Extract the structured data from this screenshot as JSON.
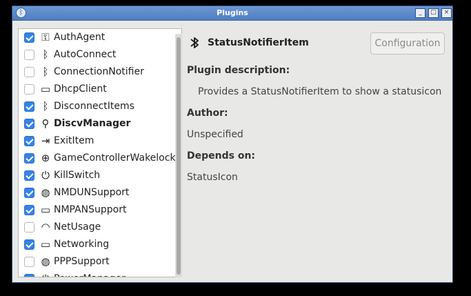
{
  "window": {
    "title": "Plugins",
    "app_icon": "bluetooth-icon",
    "controls": {
      "minimize": "_",
      "maximize": "□",
      "close": "×"
    }
  },
  "plugins": [
    {
      "name": "AuthAgent",
      "checked": true,
      "icon": "key-icon",
      "glyph": "⚿"
    },
    {
      "name": "AutoConnect",
      "checked": false,
      "icon": "bluetooth-icon",
      "glyph": "ᛒ"
    },
    {
      "name": "ConnectionNotifier",
      "checked": false,
      "icon": "bluetooth-icon",
      "glyph": "ᛒ"
    },
    {
      "name": "DhcpClient",
      "checked": false,
      "icon": "computer-icon",
      "glyph": "▭"
    },
    {
      "name": "DisconnectItems",
      "checked": true,
      "icon": "bluetooth-disabled-icon",
      "glyph": "ᛒ"
    },
    {
      "name": "DiscvManager",
      "checked": true,
      "icon": "search-icon",
      "glyph": "⚲",
      "bold": true
    },
    {
      "name": "ExitItem",
      "checked": true,
      "icon": "exit-icon",
      "glyph": "⇥"
    },
    {
      "name": "GameControllerWakelock",
      "checked": true,
      "icon": "gamepad-icon",
      "glyph": "⊕"
    },
    {
      "name": "KillSwitch",
      "checked": true,
      "icon": "power-icon",
      "glyph": "⏻"
    },
    {
      "name": "NMDUNSupport",
      "checked": true,
      "icon": "network-globe-icon",
      "glyph": "◍"
    },
    {
      "name": "NMPANSupport",
      "checked": true,
      "icon": "computer-icon",
      "glyph": "▭"
    },
    {
      "name": "NetUsage",
      "checked": false,
      "icon": "wifi-icon",
      "glyph": "◠"
    },
    {
      "name": "Networking",
      "checked": true,
      "icon": "computer-icon",
      "glyph": "▭"
    },
    {
      "name": "PPPSupport",
      "checked": false,
      "icon": "network-globe-icon",
      "glyph": "◍"
    },
    {
      "name": "PowerManager",
      "checked": true,
      "icon": "power-icon",
      "glyph": "⏻"
    }
  ],
  "details": {
    "plugin_name": "StatusNotifierItem",
    "header_icon": "bluetooth-icon",
    "configuration_button": "Configuration",
    "description_label": "Plugin description:",
    "description": "Provides a StatusNotifierItem to show a statusicon",
    "author_label": "Author:",
    "author": "Unspecified",
    "depends_label": "Depends on:",
    "depends": "StatusIcon"
  }
}
